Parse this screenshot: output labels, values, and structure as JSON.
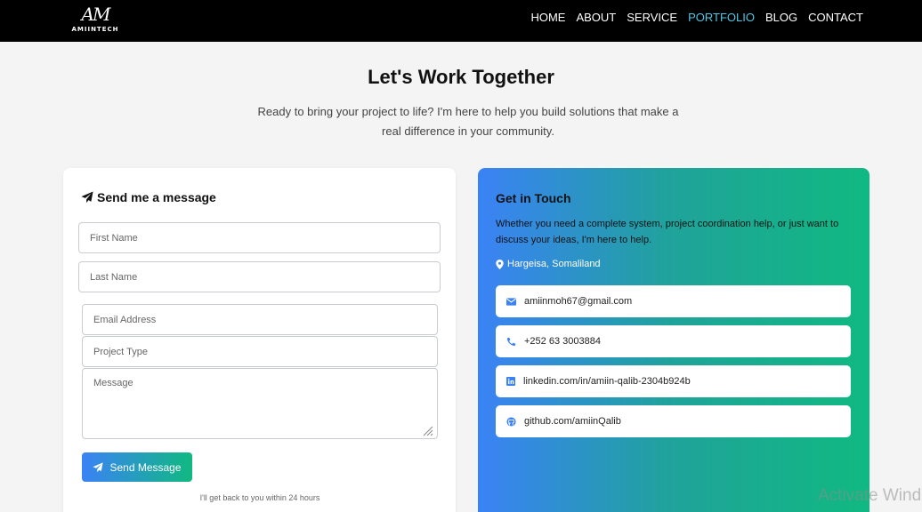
{
  "header": {
    "logo_mark": "AM",
    "logo_text": "AMIINTECH",
    "nav": [
      "HOME",
      "ABOUT",
      "SERVICE",
      "PORTFOLIO",
      "BLOG",
      "CONTACT"
    ],
    "active_nav": "PORTFOLIO",
    "active_color": "#4fc7e4"
  },
  "hero": {
    "title": "Let's Work Together",
    "subtitle": "Ready to bring your project to life? I'm here to help you build solutions that make a real difference in your community."
  },
  "form": {
    "heading": "Send me a message",
    "heading_icon": "paper-plane-icon",
    "fields": {
      "first_name": "First Name",
      "last_name": "Last Name",
      "email": "Email Address",
      "project_type": "Project Type",
      "message": "Message"
    },
    "send_label": "Send Message",
    "send_icon": "paper-plane-icon",
    "reply_note": "I'll get back to you within 24 hours"
  },
  "info": {
    "title": "Get in Touch",
    "description": "Whether you need a complete system, project coordination help, or just want to discuss your ideas, I'm here to help.",
    "location": "Hargeisa, Somaliland",
    "location_icon": "map-pin-icon",
    "contacts": [
      {
        "icon": "envelope-icon",
        "text": "amiinmoh67@gmail.com"
      },
      {
        "icon": "phone-icon",
        "text": "+252 63 3003884"
      },
      {
        "icon": "linkedin-icon",
        "text": "linkedin.com/in/amiin-qalib-2304b924b"
      },
      {
        "icon": "github-icon",
        "text": "github.com/amiinQalib"
      }
    ],
    "gradient": [
      "#3b82f6",
      "#10b981"
    ]
  },
  "watermark": "Activate Windows"
}
